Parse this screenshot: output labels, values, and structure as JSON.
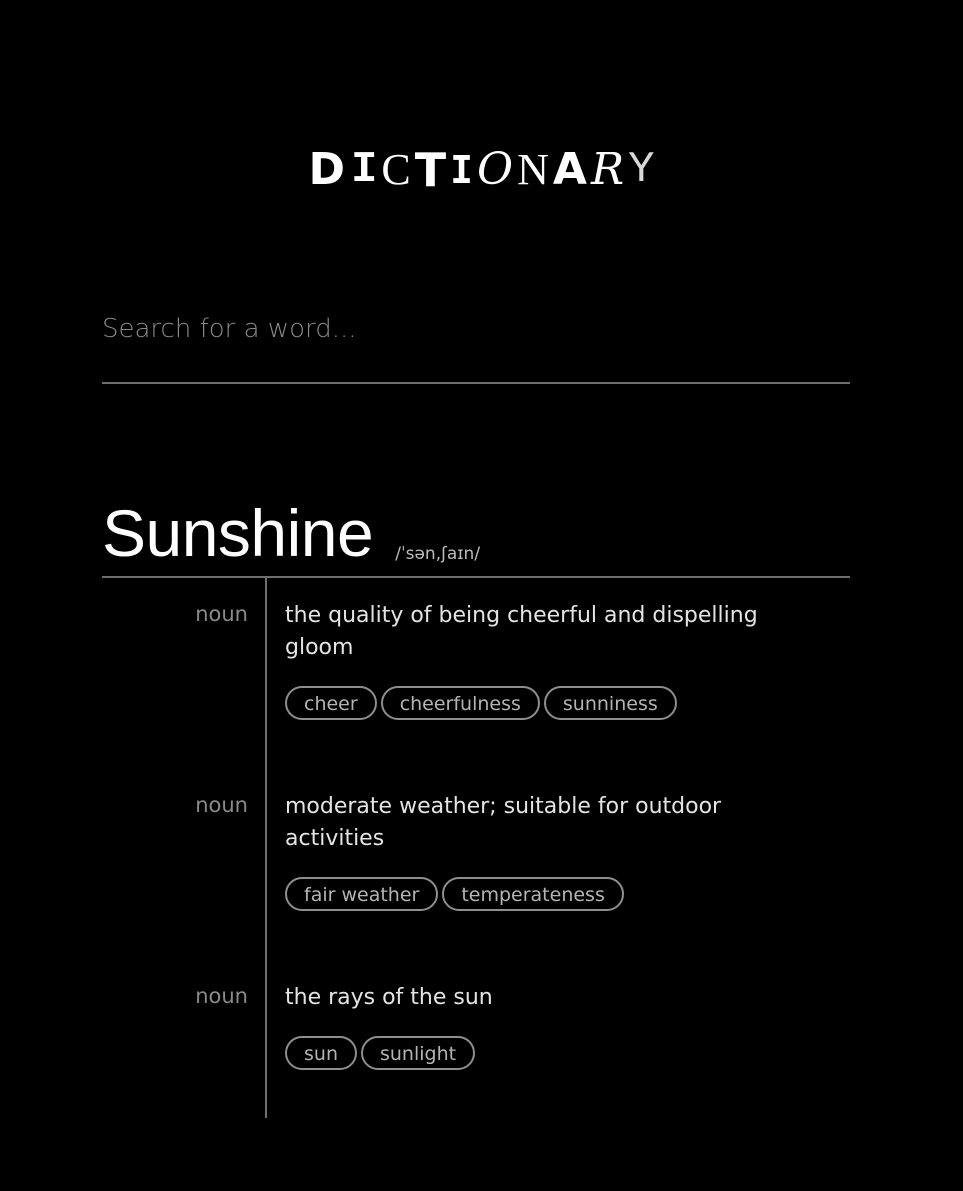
{
  "logo": {
    "letters": [
      "D",
      "I",
      "C",
      "T",
      "I",
      "O",
      "N",
      "A",
      "R",
      "Y"
    ]
  },
  "search": {
    "placeholder": "Search for a word...",
    "value": ""
  },
  "entry": {
    "word": "Sunshine",
    "phonetic": "/ˈsən,ʃaɪn/",
    "senses": [
      {
        "pos": "noun",
        "definition": "the quality of being cheerful and dispelling gloom",
        "synonyms": [
          "cheer",
          "cheerfulness",
          "sunniness"
        ]
      },
      {
        "pos": "noun",
        "definition": "moderate weather; suitable for outdoor activities",
        "synonyms": [
          "fair weather",
          "temperateness"
        ]
      },
      {
        "pos": "noun",
        "definition": "the rays of the sun",
        "synonyms": [
          "sun",
          "sunlight"
        ]
      }
    ]
  },
  "colors": {
    "background": "#000000",
    "text": "#e4e4e4",
    "muted": "#8a8a8a",
    "divider": "#6e6e6e"
  }
}
